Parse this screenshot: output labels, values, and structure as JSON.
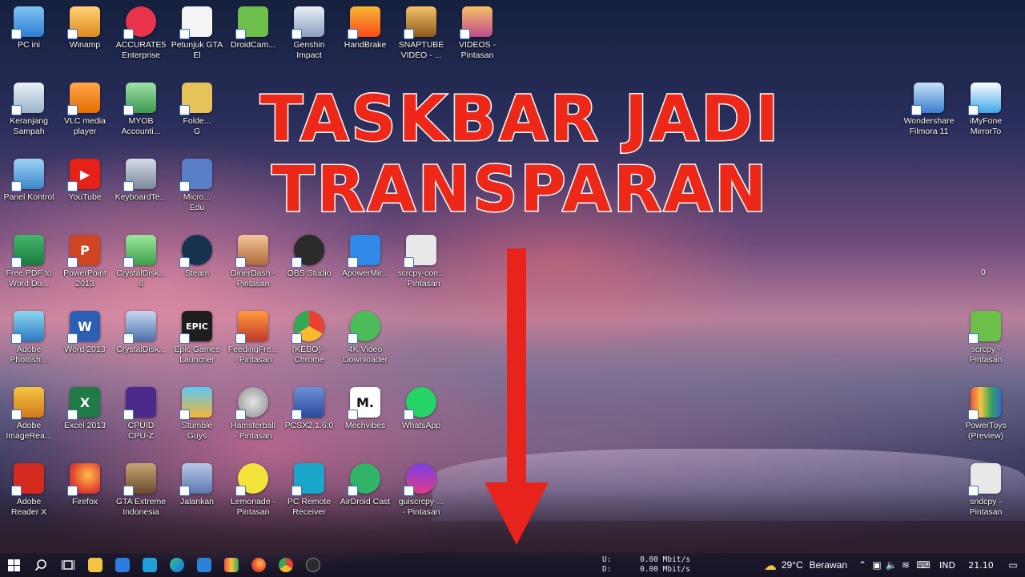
{
  "headline": {
    "line1": "TASKBAR JADI",
    "line2": "TRANSPARAN"
  },
  "desktop_icons": {
    "pc_ini": "PC ini",
    "winamp": "Winamp",
    "accurate": "ACCURATE5\nEnterprise",
    "petunjuk_gta": "Petunjuk GTA\nEl",
    "droidcam": "DroidCam...",
    "genshin": "Genshin\nImpact",
    "handbrake": "HandBrake",
    "snaptube": "SNAPTUBE\nVIDEO - ...",
    "videos": "VIDEOS -\nPintasan",
    "recycle": "Keranjang\nSampah",
    "vlc": "VLC media\nplayer",
    "myob": "MYOB\nAccounti...",
    "folder_g": "Folde...\nG",
    "panel": "Panel Kontrol",
    "youtube": "YouTube",
    "keyboard": "KeyboardTe...",
    "micro_edu": "Micro...\nEdu",
    "pdf_word": "Free PDF to\nWord Do...",
    "powerpoint": "PowerPoint\n2013",
    "crystal1": "CrystalDisk...\n8",
    "steam": "Steam",
    "dinerdash": "DinerDash -\nPintasan",
    "obs": "OBS Studio",
    "apowermirror": "ApowerMir...",
    "scrcpy_con": "scrcpy-con...\n- Pintasan",
    "photoshop": "Adobe\nPhotosh...",
    "word": "Word 2013",
    "crystal2": "CrystalDisk...",
    "epic": "Epic Games\nLauncher",
    "feeding": "FeedingFre...\n- Pintasan",
    "kebo": "(KEBO) -\nChrome",
    "k4video": "4K Video\nDownloader",
    "imageready": "Adobe\nImageRea...",
    "excel": "Excel 2013",
    "cpuz": "CPUID\nCPU-Z",
    "stumble": "Stumble\nGuys",
    "hamsterball": "Hamsterball\n- Pintasan",
    "pcsx2": "PCSX2 1.6.0",
    "mechvibes": "Mechvibes",
    "whatsapp": "WhatsApp",
    "acrobat": "Adobe\nReader X",
    "firefox": "Firefox",
    "gta": "GTA Extreme\nIndonesia",
    "jalankan": "Jalankan",
    "lemonade": "Lemonade -\nPintasan",
    "pcremote": "PC Remote\nReceiver",
    "airdroid": "AirDroid Cast",
    "guiscrcpy": "guiscrcpy-...\n- Pintasan",
    "filmora": "Wondershare\nFilmora 11",
    "imyfone": "iMyFone\nMirrorTo",
    "scrcpy": "scrcpy -\nPintasan",
    "powertoys": "PowerToys\n(Preview)",
    "sndcpy": "sndcpy -\nPintasan"
  },
  "right_counter": "0",
  "icon_glyphs": {
    "epic": "EPIC",
    "mechvibes": "M.",
    "word": "W",
    "excel": "X",
    "powerpoint": "P",
    "youtube": "▶"
  },
  "netmeter": {
    "up_label": "U:",
    "up_value": "0.00 Mbit/s",
    "down_label": "D:",
    "down_value": "0.00 Mbit/s"
  },
  "tray": {
    "temperature": "29°C",
    "weather_text": "Berawan",
    "language": "IND",
    "time": "21.10"
  },
  "colors": {
    "headline_red": "#ee2818",
    "arrow_red": "#e8231c"
  }
}
